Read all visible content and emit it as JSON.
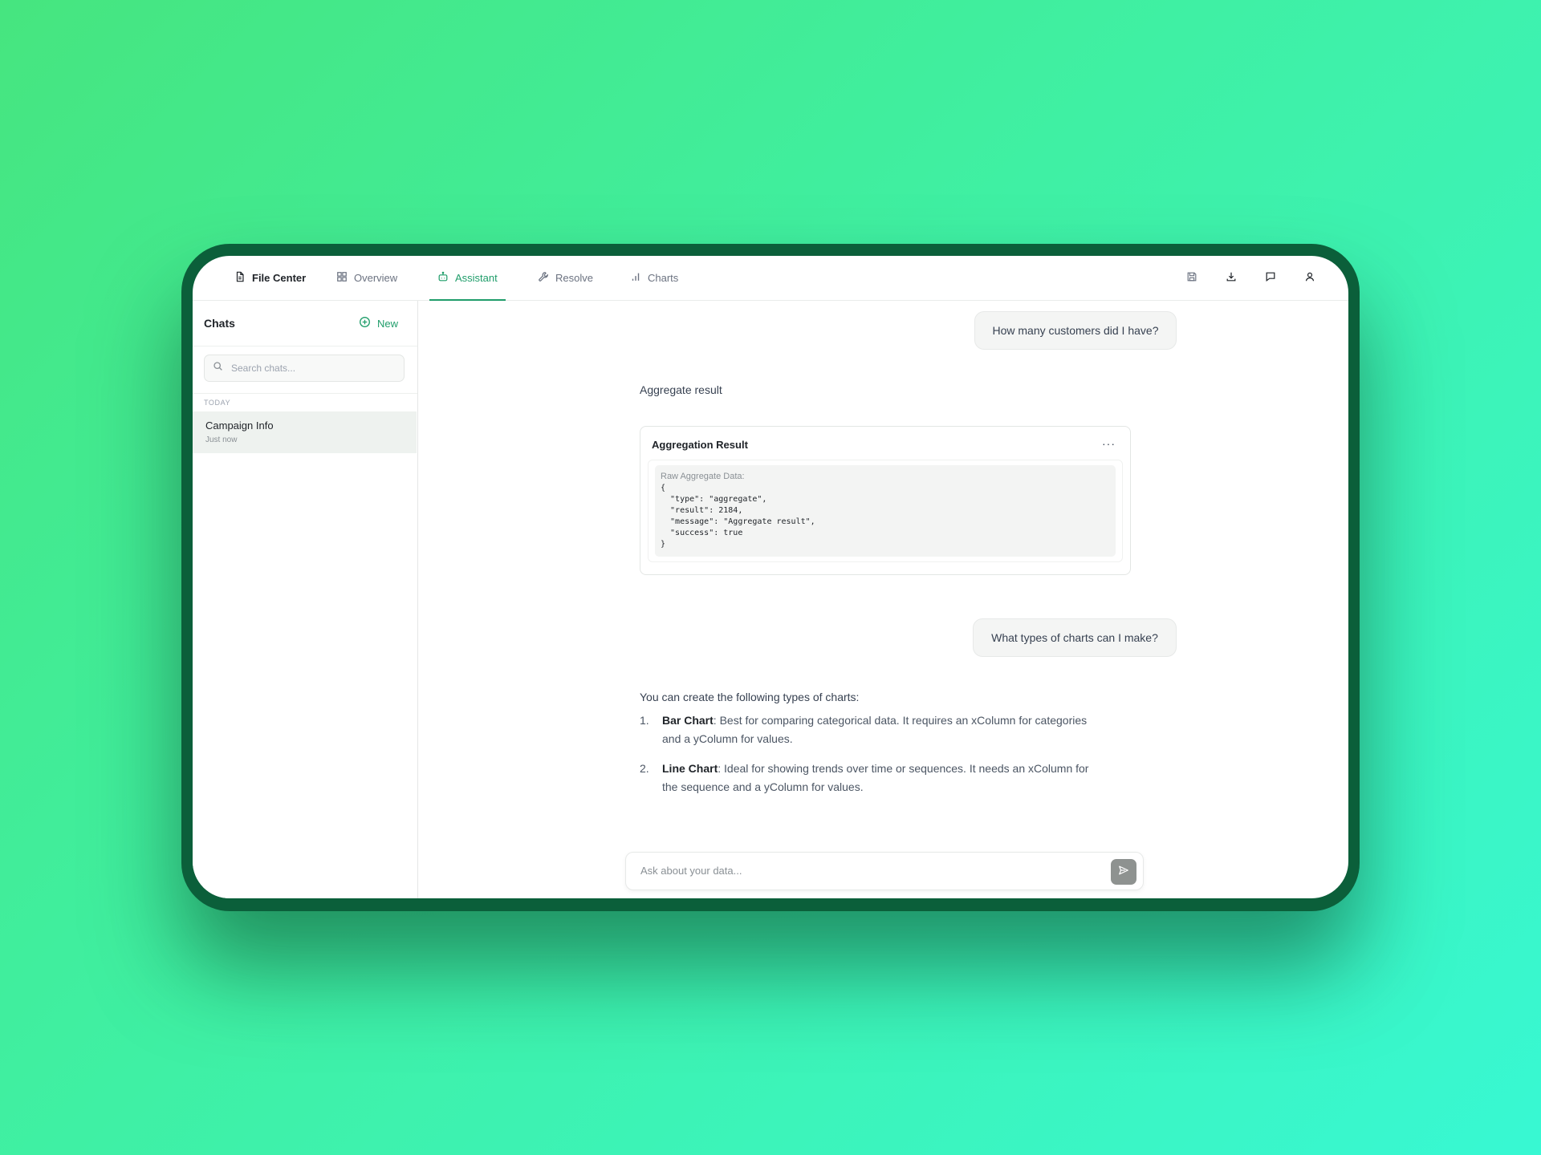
{
  "nav": {
    "tabs": [
      {
        "label": "File Center",
        "icon": "file-icon"
      },
      {
        "label": "Overview",
        "icon": "grid-icon"
      },
      {
        "label": "Assistant",
        "icon": "bot-icon"
      },
      {
        "label": "Resolve",
        "icon": "wrench-icon"
      },
      {
        "label": "Charts",
        "icon": "bar-chart-icon"
      }
    ],
    "active_tab": "Assistant",
    "toolbar_icons": [
      "save-icon",
      "download-icon",
      "comment-icon",
      "user-icon"
    ]
  },
  "sidebar": {
    "title": "Chats",
    "new_label": "New",
    "search_placeholder": "Search chats...",
    "group_label": "TODAY",
    "chats": [
      {
        "title": "Campaign Info",
        "time": "Just now"
      }
    ]
  },
  "conversation": {
    "user_q1": "How many customers did I have?",
    "ai_intro1": "Aggregate result",
    "card_title": "Aggregation Result",
    "card_menu": "···",
    "code_label": "Raw Aggregate Data:",
    "code": "{\n  \"type\": \"aggregate\",\n  \"result\": 2184,\n  \"message\": \"Aggregate result\",\n  \"success\": true\n}",
    "user_q2": "What types of charts can I make?",
    "ai_intro2": "You can create the following types of charts:",
    "list": [
      {
        "num": "1.",
        "title": "Bar Chart",
        "text": ": Best for comparing categorical data. It requires an xColumn for categories and a yColumn for values."
      },
      {
        "num": "2.",
        "title": "Line Chart",
        "text": ": Ideal for showing trends over time or sequences. It needs an xColumn for the sequence and a yColumn for values."
      }
    ]
  },
  "composer": {
    "placeholder": "Ask about your data..."
  },
  "colors": {
    "accent": "#1f9d6a",
    "device_frame": "#0b5f3a",
    "background_start": "#46e57f",
    "background_end": "#38f8d3"
  }
}
